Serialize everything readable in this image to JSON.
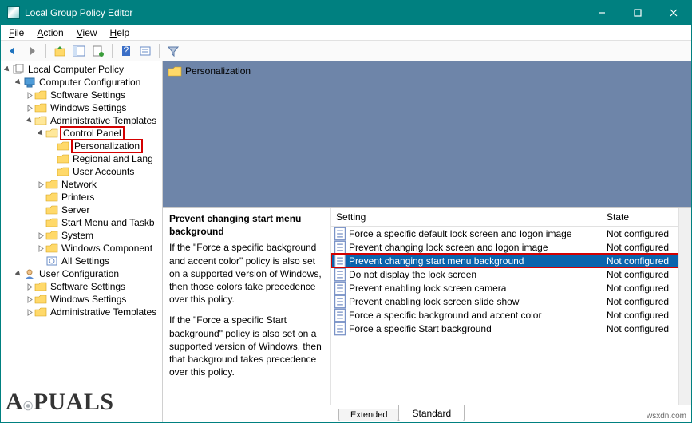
{
  "window": {
    "title": "Local Group Policy Editor"
  },
  "menu": {
    "file": "File",
    "action": "Action",
    "view": "View",
    "help": "Help"
  },
  "tree": {
    "root": "Local Computer Policy",
    "comp_config": "Computer Configuration",
    "comp_children": {
      "software": "Software Settings",
      "windows": "Windows Settings",
      "admin": "Administrative Templates",
      "control_panel": "Control Panel",
      "personalization": "Personalization",
      "regional": "Regional and Lang",
      "user_accounts": "User Accounts",
      "network": "Network",
      "printers": "Printers",
      "server": "Server",
      "start_menu": "Start Menu and Taskb",
      "system": "System",
      "win_components": "Windows Component",
      "all_settings": "All Settings"
    },
    "user_config": "User Configuration",
    "user_children": {
      "software": "Software Settings",
      "windows": "Windows Settings",
      "admin": "Administrative Templates"
    }
  },
  "breadcrumb": "Personalization",
  "desc": {
    "title": "Prevent changing start menu background",
    "p1": "If the \"Force a specific background and accent color\" policy is also set on a supported version of Windows, then those colors take precedence over this policy.",
    "p2": "If the \"Force a specific Start background\" policy is also set on a supported version of Windows, then that background takes precedence over this policy."
  },
  "columns": {
    "setting": "Setting",
    "state": "State"
  },
  "settings": [
    {
      "name": "Force a specific default lock screen and logon image",
      "state": "Not configured"
    },
    {
      "name": "Prevent changing lock screen and logon image",
      "state": "Not configured"
    },
    {
      "name": "Prevent changing start menu background",
      "state": "Not configured",
      "selected": true
    },
    {
      "name": "Do not display the lock screen",
      "state": "Not configured"
    },
    {
      "name": "Prevent enabling lock screen camera",
      "state": "Not configured"
    },
    {
      "name": "Prevent enabling lock screen slide show",
      "state": "Not configured"
    },
    {
      "name": "Force a specific background and accent color",
      "state": "Not configured"
    },
    {
      "name": "Force a specific Start background",
      "state": "Not configured"
    }
  ],
  "tabs": {
    "extended": "Extended",
    "standard": "Standard"
  },
  "watermark": "A PUALS",
  "attribution": "wsxdn.com"
}
